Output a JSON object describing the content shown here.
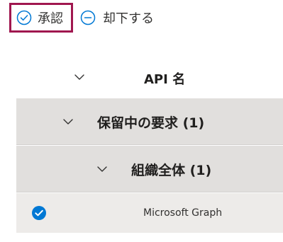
{
  "toolbar": {
    "approve_label": "承認",
    "reject_label": "却下する",
    "approve_icon": "check-circle-icon",
    "reject_icon": "minus-circle-icon"
  },
  "table": {
    "header_label": "API 名",
    "groups": [
      {
        "label": "保留中の要求 (1)"
      },
      {
        "label": "組織全体 (1)"
      }
    ],
    "rows": [
      {
        "api_name": "Microsoft Graph",
        "selected": true
      }
    ]
  },
  "colors": {
    "accent": "#0078d4",
    "highlight_border": "#a0174f",
    "group_background": "#e1dfdd",
    "row_background": "#edebe9"
  }
}
